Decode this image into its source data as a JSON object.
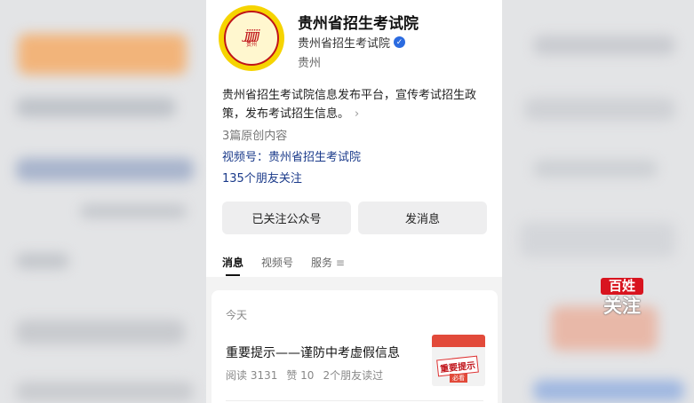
{
  "account": {
    "name": "贵州省招生考试院",
    "verified_label": "贵州省招生考试院",
    "region": "贵州",
    "description": "贵州省招生考试院信息发布平台，宣传考试招生政策，发布考试招生信息。",
    "original_count": "3篇原创内容",
    "channel": "视频号：贵州省招生考试院",
    "friends_following": "135个朋友关注",
    "logo_text": "贵州",
    "logo_mark": "jjjjjj"
  },
  "actions": {
    "follow_label": "已关注公众号",
    "message_label": "发消息"
  },
  "tabs": [
    {
      "label": "消息"
    },
    {
      "label": "视频号"
    },
    {
      "label": "服务"
    }
  ],
  "feed": {
    "date": "今天",
    "article_title": "重要提示——谨防中考虚假信息",
    "reads": "阅读 3131",
    "likes": "赞 10",
    "friends_read": "2个朋友读过",
    "thumb_text": "重要提示",
    "thumb_foot": "必看"
  },
  "watermark": {
    "top": "百姓",
    "bottom": "关注"
  },
  "colors": {
    "link": "#1a3a8a",
    "verify_badge": "#2b6be0",
    "logo_yellow": "#f6d400",
    "logo_red": "#c0141a",
    "watermark_red": "#d8141f"
  },
  "icons": [
    "verified-check-icon",
    "chevron-right-icon",
    "tab-more-icon"
  ]
}
